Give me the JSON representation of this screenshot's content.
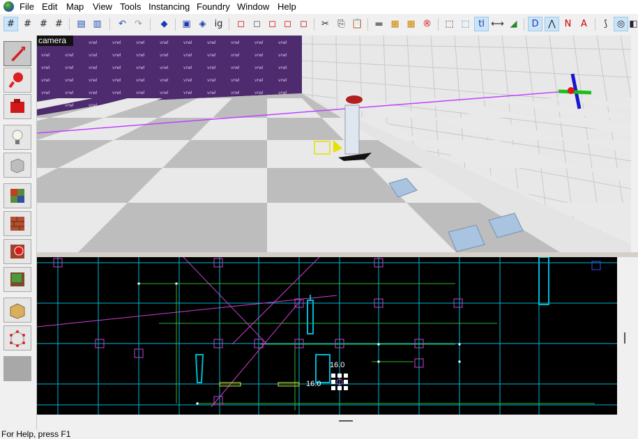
{
  "menu": [
    "File",
    "Edit",
    "Map",
    "View",
    "Tools",
    "Instancing",
    "Foundry",
    "Window",
    "Help"
  ],
  "viewport3d": {
    "label": "camera",
    "wall_texture": "vrwl"
  },
  "viewport2d": {
    "dimension_top": "16.0",
    "dimension_left": "16.0"
  },
  "status": {
    "text": "For Help, press F1"
  },
  "colors": {
    "grid_main": "#00b8d4",
    "grid_minor": "#2db82d",
    "entity": "#d040d0",
    "camera_line": "#c040ff",
    "selection": "#ffee00"
  },
  "toolbar_icons": [
    "grid-toggle-icon",
    "grid-3d-icon",
    "grid-smaller-icon",
    "grid-larger-icon",
    "group-icon",
    "ungroup-icon",
    "undo-icon",
    "redo-icon",
    "carve-icon",
    "hide-selection-icon",
    "show-selection-icon",
    "ignore-groups-icon",
    "texture-lock-icon",
    "cut-icon",
    "copy-icon",
    "paste-icon",
    "face-edit-icon",
    "texture-apply-icon",
    "replace-texture-icon",
    "run-map-icon",
    "toggle-selection-box-icon",
    "toggle-helpers-icon",
    "toggle-texlock-icon",
    "toggle-models-icon",
    "toggle-3d-icon",
    "entity-report-icon",
    "check-problems-icon",
    "map-properties-icon",
    "world-props-icon",
    "compile-icon",
    "sphere-icon",
    "overflow-icon"
  ],
  "left_tools": [
    "selection-tool-icon",
    "magnify-tool-icon",
    "camera-tool-icon",
    "entity-tool-icon",
    "block-tool-icon",
    "texture-application-icon",
    "apply-decal-icon",
    "apply-overlay-icon",
    "clipping-tool-icon",
    "vertex-tool-icon",
    "path-tool-icon",
    "blank-tool-icon"
  ]
}
